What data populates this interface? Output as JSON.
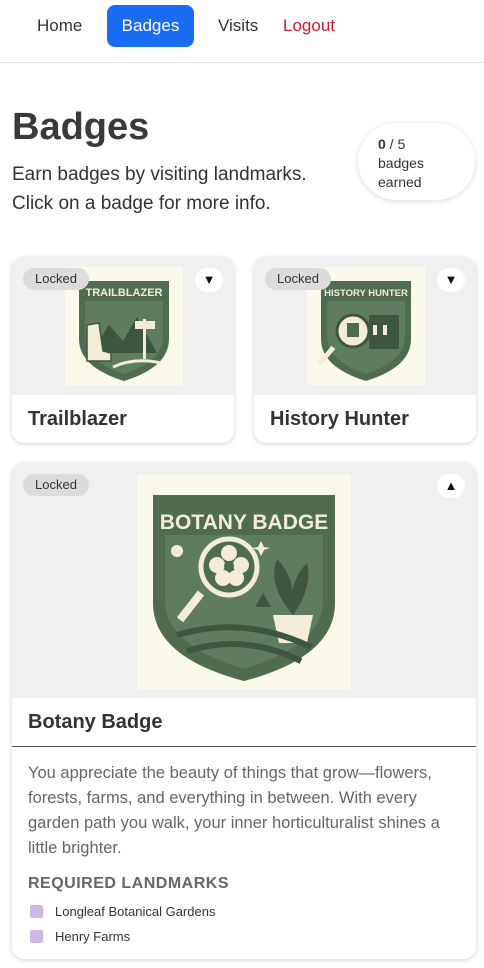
{
  "nav": {
    "home": "Home",
    "badges": "Badges",
    "visits": "Visits",
    "logout": "Logout"
  },
  "page": {
    "title": "Badges",
    "intro": "Earn badges by visiting landmarks. Click on a badge for more info."
  },
  "counter": {
    "earned": "0",
    "sep_total": " / 5",
    "label": "badges earned"
  },
  "badges": [
    {
      "status": "Locked",
      "name": "Trailblazer",
      "image_text": "TRAILBLAZER",
      "toggle": "▼"
    },
    {
      "status": "Locked",
      "name": "History Hunter",
      "image_text": "HISTORY HUNTER",
      "toggle": "▼"
    },
    {
      "status": "Locked",
      "name": "Botany Badge",
      "image_text": "BOTANY BADGE",
      "toggle": "▲",
      "description": "You appreciate the beauty of things that grow—flowers, forests, farms, and everything in between. With every garden path you walk, your inner horticulturalist shines a little brighter.",
      "required_heading": "REQUIRED LANDMARKS",
      "landmarks": [
        "Longleaf Botanical Gardens",
        "Henry Farms"
      ]
    }
  ],
  "colors": {
    "accent": "#1a6cf2",
    "logout": "#d01a2a",
    "badge_green": "#4f6b52",
    "badge_cream": "#f3ecd6",
    "bullet": "#cdb8e6"
  }
}
